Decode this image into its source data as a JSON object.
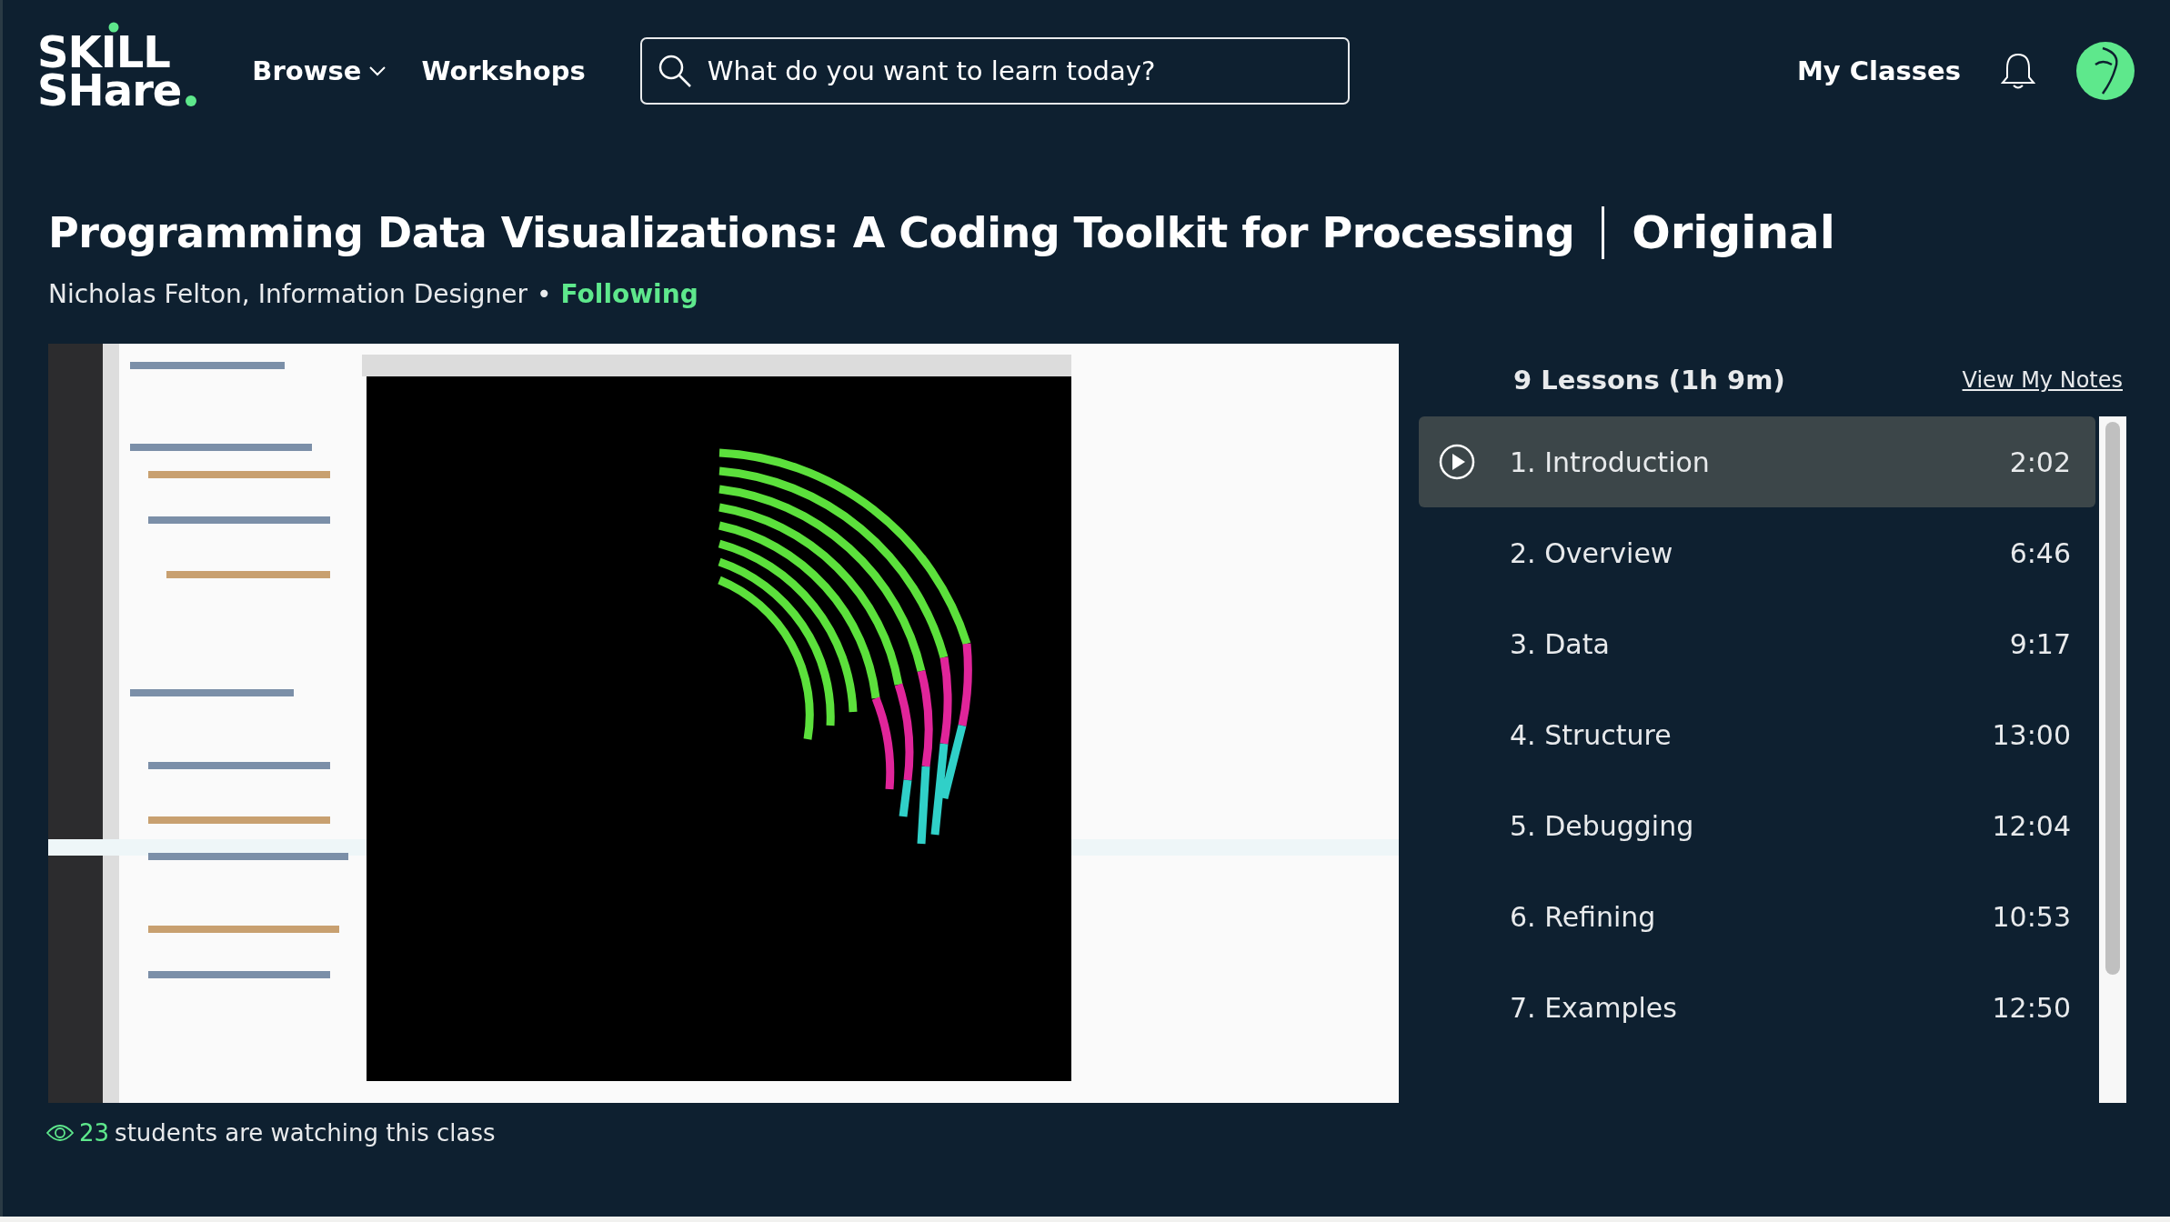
{
  "header": {
    "logo": [
      "SKILL",
      "SHare"
    ],
    "nav": [
      {
        "label": "Browse",
        "dropdown": true
      },
      {
        "label": "Workshops",
        "dropdown": false
      }
    ],
    "search": {
      "placeholder": "What do you want to learn today?"
    },
    "my_classes": "My Classes"
  },
  "class": {
    "title": "Programming Data Visualizations: A Coding Toolkit for Processing",
    "badge": "Original",
    "author": "Nicholas Felton, Information Designer",
    "separator": "•",
    "follow": "Following"
  },
  "lessons": {
    "heading": "9 Lessons (1h 9m)",
    "notes_link": "View My Notes",
    "items": [
      {
        "title": "1. Introduction",
        "duration": "2:02",
        "selected": true
      },
      {
        "title": "2. Overview",
        "duration": "6:46",
        "selected": false
      },
      {
        "title": "3. Data",
        "duration": "9:17",
        "selected": false
      },
      {
        "title": "4. Structure",
        "duration": "13:00",
        "selected": false
      },
      {
        "title": "5. Debugging",
        "duration": "12:04",
        "selected": false
      },
      {
        "title": "6. Refining",
        "duration": "10:53",
        "selected": false
      },
      {
        "title": "7. Examples",
        "duration": "12:50",
        "selected": false
      }
    ]
  },
  "watching": {
    "count": "23",
    "text": "students are watching this class"
  }
}
